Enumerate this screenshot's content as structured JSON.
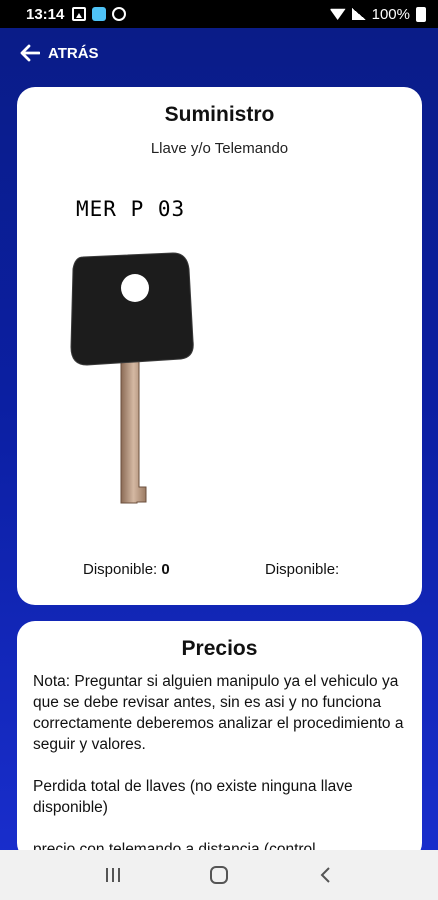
{
  "status_bar": {
    "time": "13:14",
    "battery": "100%"
  },
  "header": {
    "back_label": "ATRÁS"
  },
  "supply_card": {
    "title": "Suministro",
    "subtitle": "Llave y/o Telemando",
    "key_code": "MER P 03",
    "available_1_label": "Disponible:",
    "available_1_value": "0",
    "available_2_label": "Disponible:",
    "available_2_value": ""
  },
  "prices_card": {
    "title": "Precios",
    "note": "Nota: Preguntar si alguien manipulo ya el vehiculo ya que se debe revisar antes, sin es asi y no funciona correctamente deberemos analizar el procedimiento a seguir y valores.",
    "total_loss": "Perdida total de llaves (no existe ninguna llave disponible)",
    "remote_price": "precio con telemando a distancia (control"
  },
  "colors": {
    "background": "#0b1fa2",
    "card": "#ffffff",
    "nav_bar": "#f1f1f1"
  }
}
